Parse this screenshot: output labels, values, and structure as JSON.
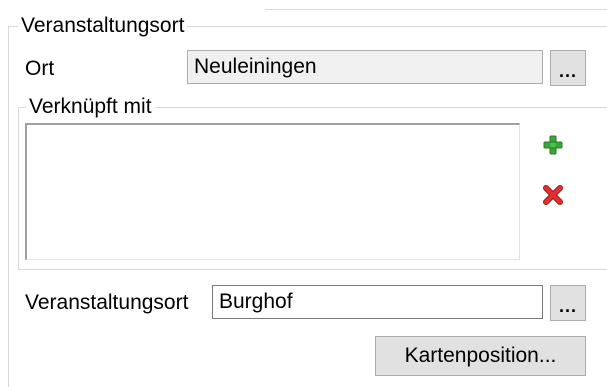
{
  "venue_group": {
    "legend": "Veranstaltungsort",
    "ort_label": "Ort",
    "ort_value": "Neuleiningen",
    "ort_browse_label": "...",
    "linked_group": {
      "legend": "Verknüpft mit",
      "items": [],
      "add_icon": "plus-icon",
      "remove_icon": "cross-icon"
    },
    "venue_label": "Veranstaltungsort",
    "venue_value": "Burghof",
    "venue_browse_label": "...",
    "map_position_button": "Kartenposition..."
  },
  "colors": {
    "add_green": "#3aa63a",
    "remove_red": "#e03030",
    "button_face": "#e1e1e1",
    "group_border": "#d9d9d9"
  }
}
